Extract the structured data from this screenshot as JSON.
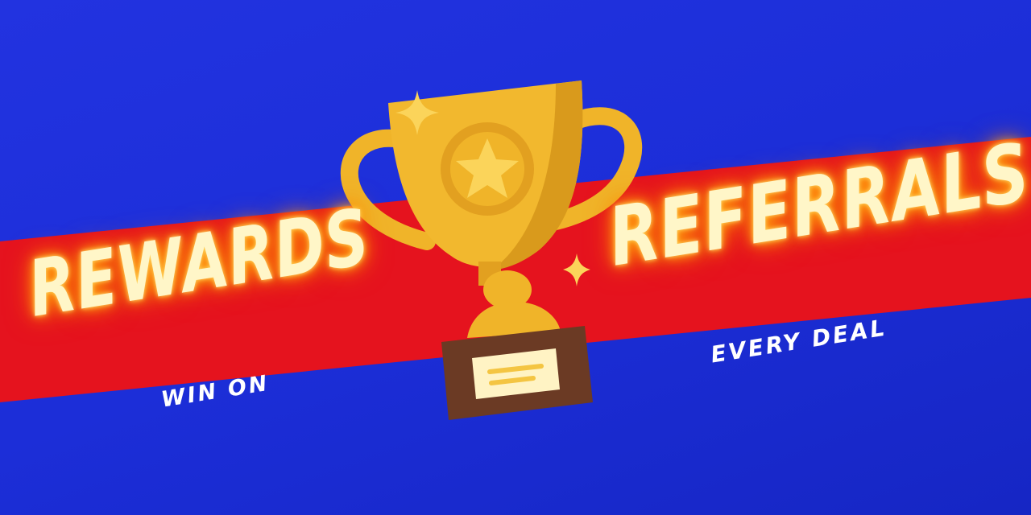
{
  "banner": {
    "headline_left": "REWARDS",
    "headline_right": "REFERRALS",
    "tagline_left": "WIN ON",
    "tagline_right": "EVERY DEAL"
  },
  "colors": {
    "background": "#1f30dc",
    "stripe": "#e5131e",
    "headline_text": "#fff6c8",
    "glow": "#ff8a00",
    "trophy_gold": "#f0b429",
    "trophy_shadow": "#d4901a",
    "plaque_base": "#6b3a24",
    "plaque_label": "#fff3c4"
  },
  "icons": {
    "trophy": "trophy-icon",
    "star": "star-icon",
    "sparkle": "sparkle-icon"
  }
}
